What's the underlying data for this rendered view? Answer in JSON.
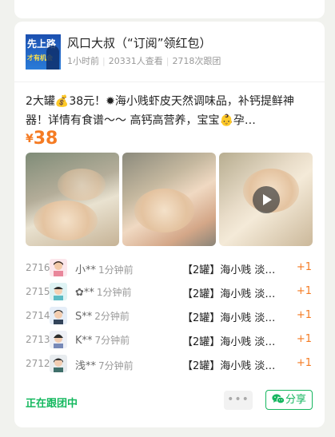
{
  "post": {
    "author": "风口大叔（“订阅”领红包）",
    "avatar_text_line1": "先上路",
    "avatar_text_line2": "才有机会",
    "avatar_text_side": "行者",
    "time": "1小时前",
    "views": "20331人查看",
    "follows": "2718次跟团",
    "description": "2大罐💰38元！✹海小贱虾皮天然调味品，补钙提鲜神器！详情有食谱～～ 高钙高营养，宝宝👶孕…",
    "price_symbol": "¥",
    "price": "38",
    "images": [
      "shrimp-photo-1",
      "shrimp-photo-2",
      "shrimp-video-3"
    ]
  },
  "orders": [
    {
      "no": "2716",
      "name": "小**",
      "time": "1分钟前",
      "item": "【2罐】海小贱 淡…",
      "qty": "+1"
    },
    {
      "no": "2715",
      "name": "✿**",
      "time": "1分钟前",
      "item": "【2罐】海小贱 淡…",
      "qty": "+1"
    },
    {
      "no": "2714",
      "name": "S**",
      "time": "2分钟前",
      "item": "【2罐】海小贱 淡…",
      "qty": "+1"
    },
    {
      "no": "2713",
      "name": "K**",
      "time": "7分钟前",
      "item": "【2罐】海小贱 淡…",
      "qty": "+1"
    },
    {
      "no": "2712",
      "name": "浅**",
      "time": "7分钟前",
      "item": "【2罐】海小贱 淡…",
      "qty": "+1"
    }
  ],
  "footer": {
    "status": "正在跟团中",
    "more_label": "•••",
    "share_label": "分享"
  },
  "colors": {
    "accent_orange": "#f57b23",
    "accent_green": "#16b65f",
    "background": "#f1f2ee"
  }
}
